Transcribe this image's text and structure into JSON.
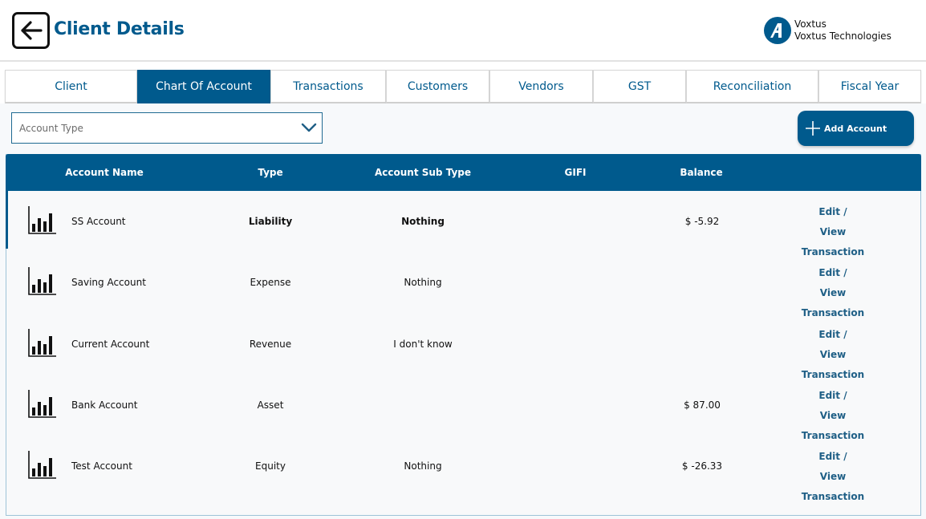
{
  "header": {
    "title": "Client Details",
    "brand_name": "Voxtus",
    "brand_subtitle": "Voxtus Technologies",
    "brand_color": "#005a8d"
  },
  "icons": {
    "back": "arrow-left-icon",
    "logo": "brand-logo-icon",
    "chevron": "chevron-down-icon",
    "add": "plus-icon",
    "row": "bar-chart-icon"
  },
  "tabs": [
    {
      "label": "Client",
      "active": false
    },
    {
      "label": "Chart Of Account",
      "active": true
    },
    {
      "label": "Transactions",
      "active": false
    },
    {
      "label": "Customers",
      "active": false
    },
    {
      "label": "Vendors",
      "active": false
    },
    {
      "label": "GST",
      "active": false
    },
    {
      "label": "Reconciliation",
      "active": false
    },
    {
      "label": "Fiscal Year",
      "active": false
    }
  ],
  "filter": {
    "account_type_placeholder": "Account Type",
    "add_account_label": "Add Account"
  },
  "table": {
    "columns": {
      "name": "Account Name",
      "type": "Type",
      "sub_type": "Account Sub Type",
      "gifi": "GIFI",
      "balance": "Balance"
    },
    "rows": [
      {
        "name": "SS Account",
        "type": "Liability",
        "sub_type": "Nothing",
        "gifi": "",
        "balance": "$ -5.92",
        "edit": "Edit /",
        "view": "View Transaction",
        "selected": true
      },
      {
        "name": "Saving Account",
        "type": "Expense",
        "sub_type": "Nothing",
        "gifi": "",
        "balance": "",
        "edit": "Edit /",
        "view": "View Transaction",
        "selected": false
      },
      {
        "name": "Current Account",
        "type": "Revenue",
        "sub_type": "I don't know",
        "gifi": "",
        "balance": "",
        "edit": "Edit /",
        "view": "View Transaction",
        "selected": false
      },
      {
        "name": "Bank Account",
        "type": "Asset",
        "sub_type": "",
        "gifi": "",
        "balance": "$ 87.00",
        "edit": "Edit /",
        "view": "View Transaction",
        "selected": false
      },
      {
        "name": "Test Account",
        "type": "Equity",
        "sub_type": "Nothing",
        "gifi": "",
        "balance": "$ -26.33",
        "edit": "Edit /",
        "view": "View Transaction",
        "selected": false
      }
    ]
  }
}
